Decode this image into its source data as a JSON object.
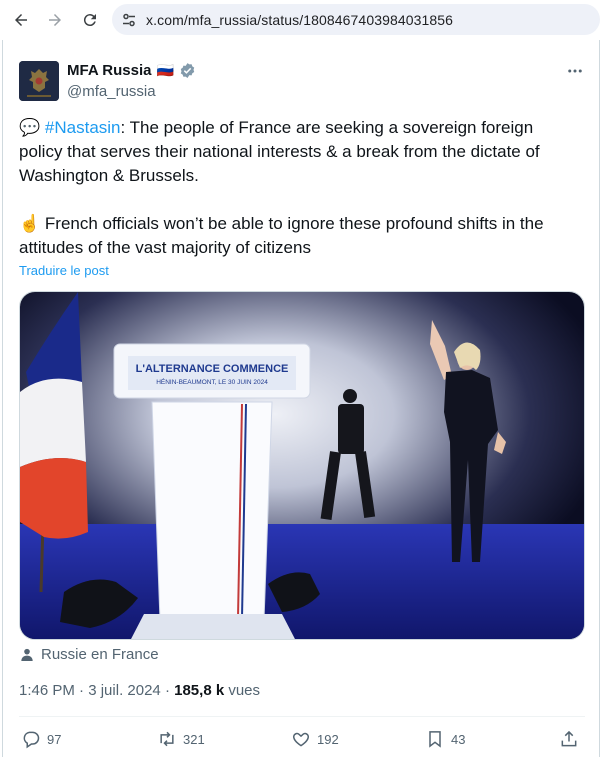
{
  "browser": {
    "url": "x.com/mfa_russia/status/1808467403984031856",
    "back_icon": "arrow-left-icon",
    "forward_icon": "arrow-right-icon",
    "reload_icon": "reload-icon"
  },
  "tweet": {
    "display_name": "MFA Russia",
    "flag_emoji": "🇷🇺",
    "handle": "@mfa_russia",
    "speech_emoji": "💬",
    "hashtag": "#Nastasin",
    "text_part1": ": The people of France are seeking a sovereign foreign policy that serves their national interests & a break from the dictate of Washington & Brussels.",
    "pointing_emoji": "☝️",
    "text_part2": " French officials won’t be able to ignore these profound shifts in the attitudes of the vast majority of citizens",
    "translate_label": "Traduire le post",
    "media": {
      "podium_line1": "L'ALTERNANCE COMMENCE",
      "podium_line2": "HÉNIN-BEAUMONT, LE 30 JUIN 2024"
    },
    "location": "Russie en France",
    "time": "1:46 PM",
    "separator": " · ",
    "date": "3 juil. 2024",
    "views_count": "185,8 k",
    "views_label": " vues",
    "replies": "97",
    "reposts": "321",
    "likes": "192",
    "bookmarks": "43"
  },
  "colors": {
    "accent": "#1d9bf0",
    "verified": "#829aab",
    "secondary_text": "#536471"
  }
}
